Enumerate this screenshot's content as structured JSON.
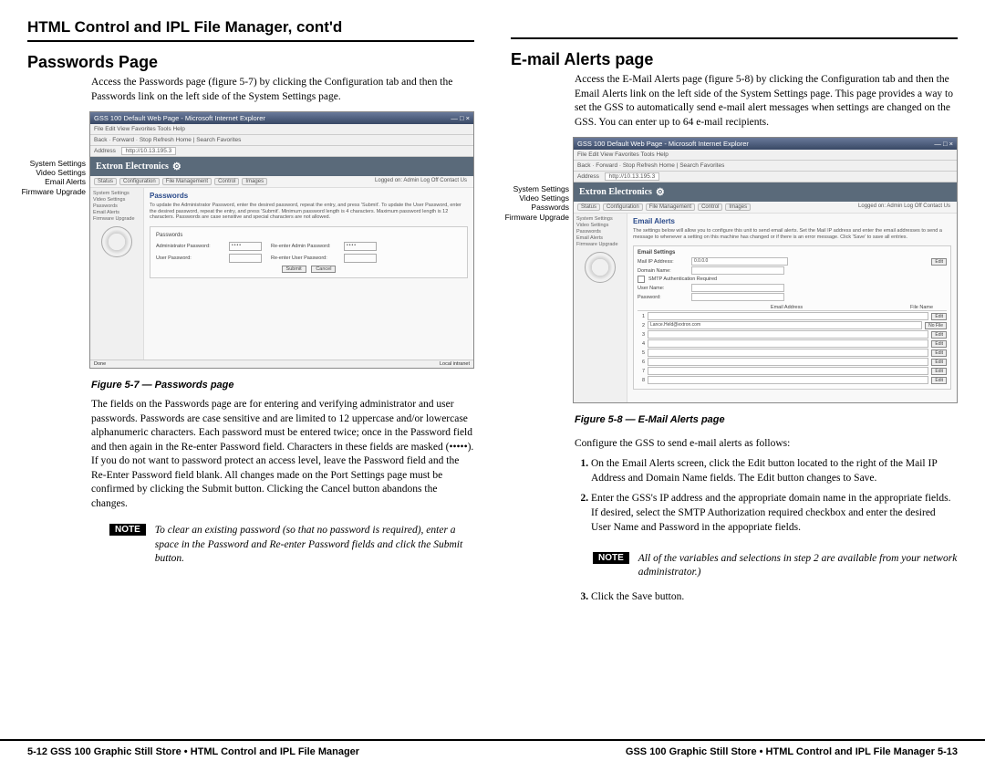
{
  "chapter_title": "HTML Control and IPL File Manager, cont'd",
  "left": {
    "section_title": "Passwords Page",
    "intro": "Access the Passwords page (figure 5-7) by clicking the Configuration tab and then the Passwords link on the left side of the System Settings page.",
    "callouts": [
      "System Settings",
      "Video Settings",
      "Email Alerts",
      "Firmware Upgrade"
    ],
    "browser": {
      "title": "GSS 100 Default Web Page - Microsoft Internet Explorer",
      "menu": "File  Edit  View  Favorites  Tools  Help",
      "toolbar": "Back  ·  Forward  ·  Stop  Refresh  Home  |  Search  Favorites",
      "address_label": "Address",
      "address_val": "http://10.13.195.3",
      "brand": "Extron Electronics",
      "tabs": [
        "Status",
        "Configuration",
        "File Management",
        "Control",
        "Images"
      ],
      "logged": "Logged on: Admin    Log Off    Contact Us",
      "sidebar": [
        "System Settings",
        "Video Settings",
        "Passwords",
        "Email Alerts",
        "Firmware Upgrade"
      ],
      "panel_title": "Passwords",
      "panel_desc": "To update the Administrator Password, enter the desired password, repeat the entry, and press 'Submit'. To update the User Password, enter the desired password, repeat the entry, and press 'Submit'. Minimum password length is 4 characters. Maximum password length is 12 characters. Passwords are case sensitive and special characters are not allowed.",
      "box_title": "Passwords",
      "rows": [
        {
          "l1": "Administrator Password:",
          "l2": "Re-enter Admin Password:",
          "dots": "••••"
        },
        {
          "l1": "User Password:",
          "l2": "Re-enter User Password:",
          "dots": ""
        }
      ],
      "submit": "Submit",
      "cancel": "Cancel",
      "status_left": "Done",
      "status_right": "Local intranet"
    },
    "fig_caption": "Figure 5-7 — Passwords page",
    "body": "The fields on the Passwords page are for entering and verifying administrator and user passwords. Passwords are case sensitive and are limited to 12 uppercase and/or lowercase alphanumeric characters. Each password must be entered twice; once in the Password field and then again in the Re-enter Password field. Characters in these fields are masked (•••••). If you do not want to password protect an access level, leave the Password field and the Re-Enter Password field blank. All changes made on the Port Settings page must be confirmed by clicking the Submit button. Clicking the Cancel button abandons the changes.",
    "note_label": "NOTE",
    "note_text": "To clear an existing password (so that no password is required), enter a space in the Password and Re-enter Password fields and click the Submit button."
  },
  "right": {
    "section_title": "E-mail Alerts page",
    "intro": "Access the E-Mail Alerts page (figure 5-8) by clicking the Configuration tab and then the Email Alerts link on the left side of the System Settings page. This page provides a way to set the GSS to automatically send e-mail alert messages when settings are changed on the GSS. You can enter up to 64 e-mail recipients.",
    "callouts": [
      "System Settings",
      "Video Settings",
      "Passwords",
      "Firmware Upgrade"
    ],
    "browser": {
      "title": "GSS 100 Default Web Page - Microsoft Internet Explorer",
      "menu": "File  Edit  View  Favorites  Tools  Help",
      "toolbar": "Back  ·  Forward  ·  Stop  Refresh  Home  |  Search  Favorites",
      "address_label": "Address",
      "address_val": "http://10.13.195.3",
      "brand": "Extron Electronics",
      "tabs": [
        "Status",
        "Configuration",
        "File Management",
        "Control",
        "Images"
      ],
      "logged": "Logged on: Admin    Log Off    Contact Us",
      "sidebar": [
        "System Settings",
        "Video Settings",
        "Passwords",
        "Email Alerts",
        "Firmware Upgrade"
      ],
      "panel_title": "Email Alerts",
      "panel_desc": "The settings below will allow you to configure this unit to send email alerts. Set the Mail IP address and enter the email addresses to send a message to whenever a setting on this machine has changed or if there is an error message. Click 'Save' to save all entries.",
      "es_title": "Email Settings",
      "es_rows": [
        {
          "lbl": "Mail IP Address:",
          "val": "0.0.0.0",
          "edit": true
        },
        {
          "lbl": "Domain Name:",
          "val": ""
        },
        {
          "lbl": "SMTP Authentication Required",
          "checkbox": true
        },
        {
          "lbl": "User Name:",
          "val": ""
        },
        {
          "lbl": "Password:",
          "val": ""
        }
      ],
      "table_hdr1": "Email Address",
      "table_hdr2": "File Name",
      "rows": [
        {
          "n": "1",
          "addr": "",
          "btn": "Edit"
        },
        {
          "n": "2",
          "addr": "Lance.Held@extron.com",
          "btn": "No File"
        },
        {
          "n": "3",
          "addr": "",
          "btn": "Edit"
        },
        {
          "n": "4",
          "addr": "",
          "btn": "Edit"
        },
        {
          "n": "5",
          "addr": "",
          "btn": "Edit"
        },
        {
          "n": "6",
          "addr": "",
          "btn": "Edit"
        },
        {
          "n": "7",
          "addr": "",
          "btn": "Edit"
        },
        {
          "n": "8",
          "addr": "",
          "btn": "Edit"
        }
      ]
    },
    "fig_caption": "Figure 5-8 — E-Mail Alerts page",
    "config_text": "Configure the GSS to send e-mail alerts as follows:",
    "steps": [
      "On the Email Alerts screen, click the Edit button located to the right of the Mail IP Address and Domain Name fields. The Edit button changes to Save.",
      "Enter the GSS's IP address and the appropriate domain name in the appropriate fields. If desired, select the SMTP Authorization required checkbox and enter the desired User Name and Password in the appopriate fields."
    ],
    "note_label": "NOTE",
    "note_text": "All of the variables and selections in step 2 are available from your network administrator.)",
    "step3": "Click the Save button."
  },
  "footer": {
    "left": "5-12  GSS 100 Graphic Still Store • HTML Control and IPL File Manager",
    "right": "GSS 100 Graphic Still Store • HTML Control and IPL File Manager  5-13"
  }
}
